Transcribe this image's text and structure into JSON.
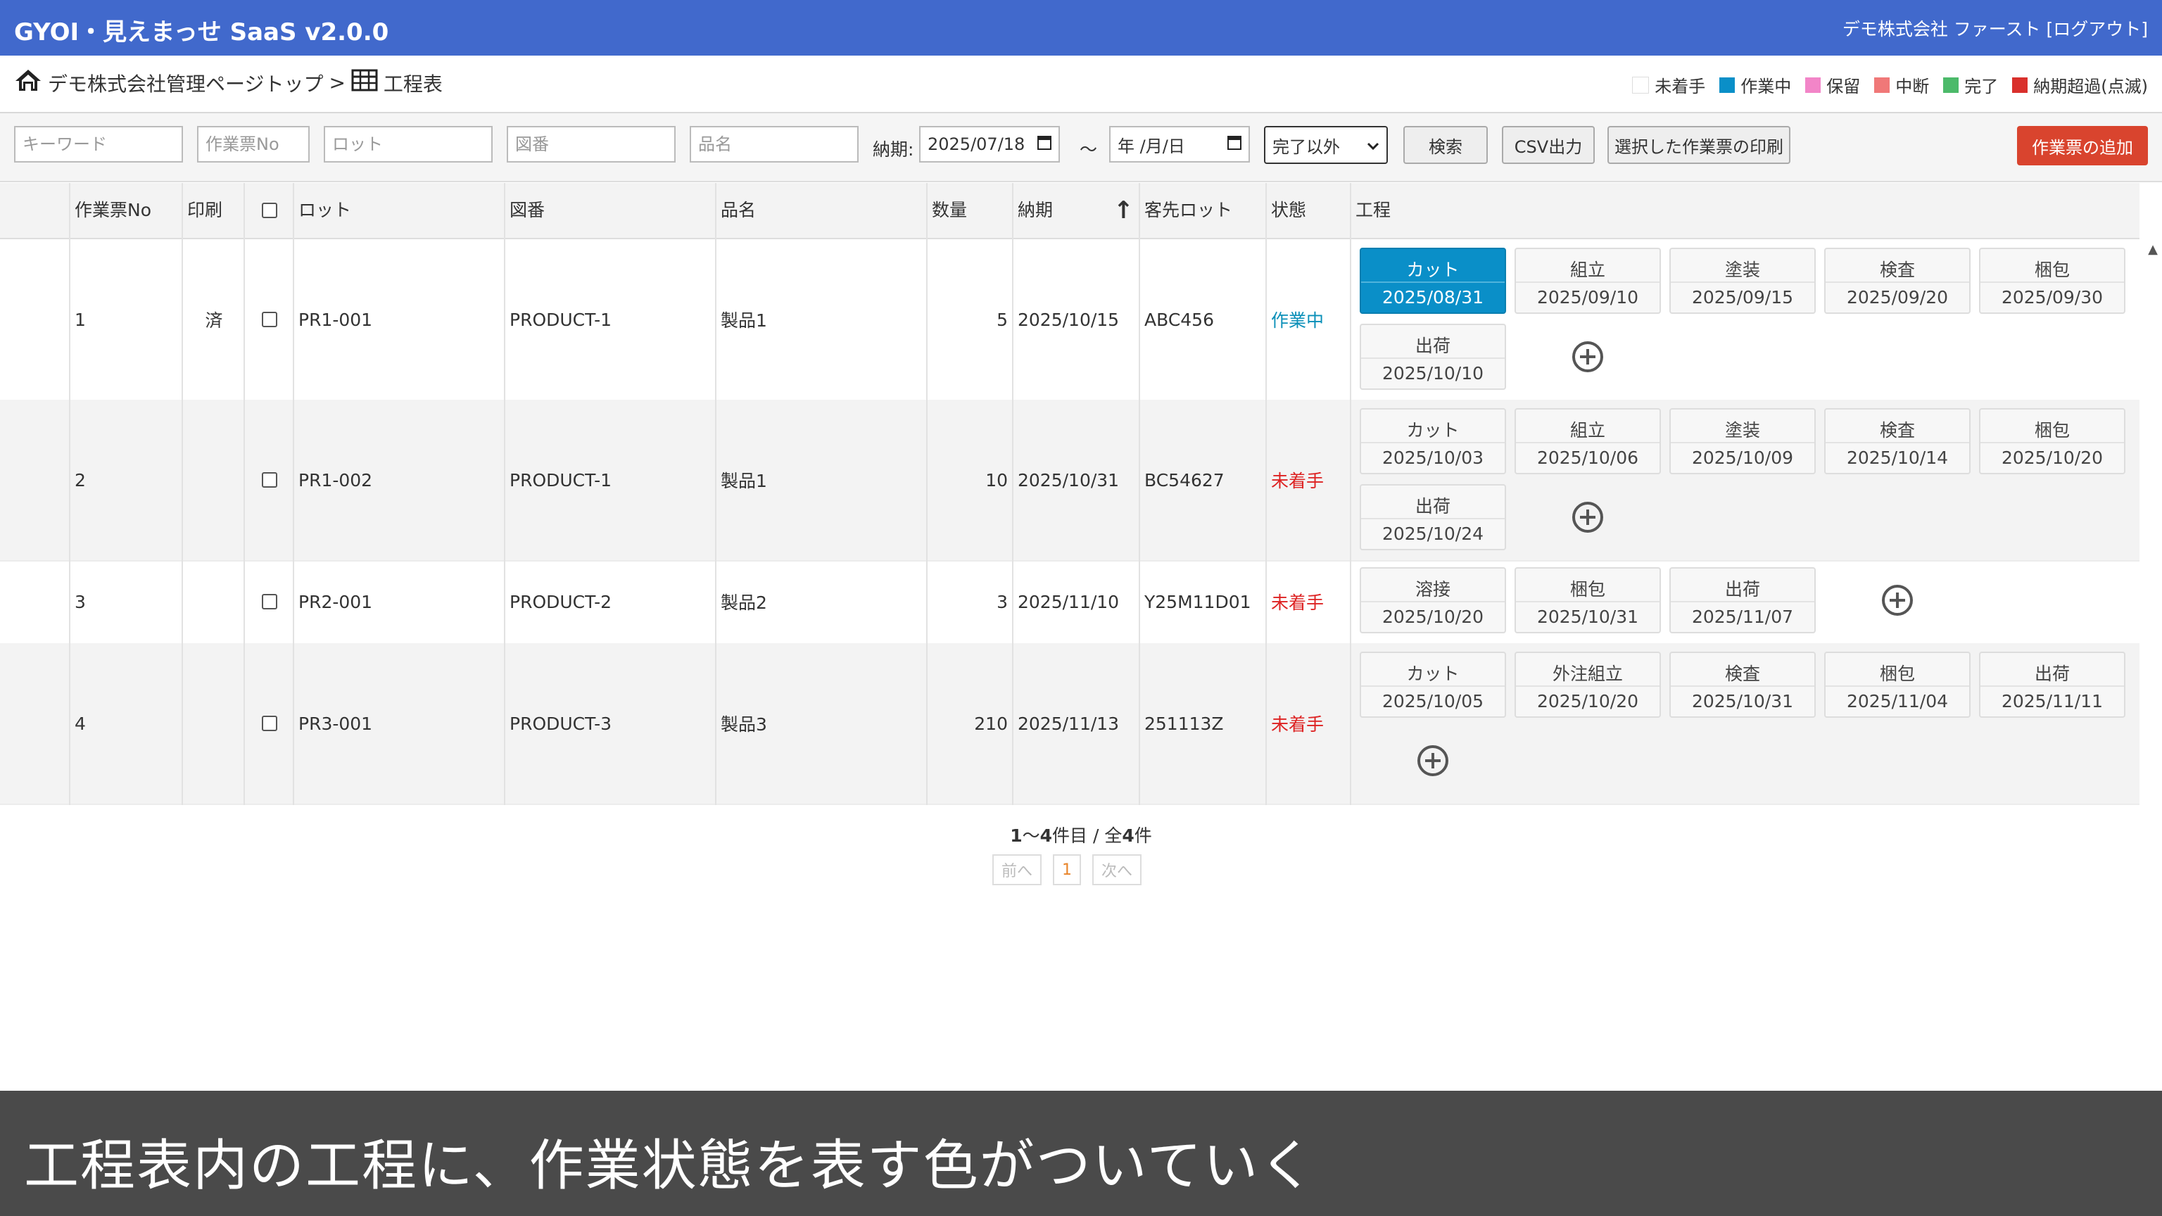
{
  "app": {
    "title": "GYOI・見えまっせ SaaS v2.0.0",
    "user_text": "デモ株式会社 ファースト [ログアウト]"
  },
  "breadcrumb": {
    "home": "デモ株式会社管理ページトップ",
    "separator": ">",
    "current": "工程表"
  },
  "legend": [
    {
      "label": "未着手",
      "color": "#ffffff"
    },
    {
      "label": "作業中",
      "color": "#0a8fc8"
    },
    {
      "label": "保留",
      "color": "#f285c8"
    },
    {
      "label": "中断",
      "color": "#f07878"
    },
    {
      "label": "完了",
      "color": "#4cba6a"
    },
    {
      "label": "納期超過(点滅)",
      "color": "#d9302c"
    }
  ],
  "filters": {
    "keyword_placeholder": "キーワード",
    "ticket_placeholder": "作業票No",
    "lot_placeholder": "ロット",
    "drawing_placeholder": "図番",
    "product_placeholder": "品名",
    "due_label": "納期:",
    "due_from": "2025/07/18",
    "tilde": "～",
    "due_to": "年 /月/日",
    "status_selected": "完了以外",
    "search": "検索",
    "csv": "CSV出力",
    "print_selected": "選択した作業票の印刷",
    "add_ticket": "作業票の追加"
  },
  "table": {
    "headers": {
      "ticket_no": "作業票No",
      "print": "印刷",
      "lot": "ロット",
      "drawing": "図番",
      "product": "品名",
      "qty": "数量",
      "due": "納期",
      "sort_icon": "↑",
      "customer_lot": "客先ロット",
      "status": "状態",
      "process": "工程"
    },
    "rows": [
      {
        "no": "1",
        "print": "済",
        "lot": "PR1-001",
        "drawing": "PRODUCT-1",
        "product": "製品1",
        "qty": "5",
        "due": "2025/10/15",
        "customer_lot": "ABC456",
        "status": "作業中",
        "procs": [
          {
            "name": "カット",
            "date": "2025/08/31",
            "state": "active"
          },
          {
            "name": "組立",
            "date": "2025/09/10"
          },
          {
            "name": "塗装",
            "date": "2025/09/15"
          },
          {
            "name": "検査",
            "date": "2025/09/20"
          },
          {
            "name": "梱包",
            "date": "2025/09/30"
          },
          {
            "name": "出荷",
            "date": "2025/10/10"
          }
        ]
      },
      {
        "no": "2",
        "print": "",
        "lot": "PR1-002",
        "drawing": "PRODUCT-1",
        "product": "製品1",
        "qty": "10",
        "due": "2025/10/31",
        "customer_lot": "BC54627",
        "status": "未着手",
        "procs": [
          {
            "name": "カット",
            "date": "2025/10/03"
          },
          {
            "name": "組立",
            "date": "2025/10/06"
          },
          {
            "name": "塗装",
            "date": "2025/10/09"
          },
          {
            "name": "検査",
            "date": "2025/10/14"
          },
          {
            "name": "梱包",
            "date": "2025/10/20"
          },
          {
            "name": "出荷",
            "date": "2025/10/24"
          }
        ]
      },
      {
        "no": "3",
        "print": "",
        "lot": "PR2-001",
        "drawing": "PRODUCT-2",
        "product": "製品2",
        "qty": "3",
        "due": "2025/11/10",
        "customer_lot": "Y25M11D01",
        "status": "未着手",
        "procs": [
          {
            "name": "溶接",
            "date": "2025/10/20"
          },
          {
            "name": "梱包",
            "date": "2025/10/31"
          },
          {
            "name": "出荷",
            "date": "2025/11/07"
          }
        ]
      },
      {
        "no": "4",
        "print": "",
        "lot": "PR3-001",
        "drawing": "PRODUCT-3",
        "product": "製品3",
        "qty": "210",
        "due": "2025/11/13",
        "customer_lot": "251113Z",
        "status": "未着手",
        "procs": [
          {
            "name": "カット",
            "date": "2025/10/05"
          },
          {
            "name": "外注組立",
            "date": "2025/10/20"
          },
          {
            "name": "検査",
            "date": "2025/10/31"
          },
          {
            "name": "梱包",
            "date": "2025/11/04"
          },
          {
            "name": "出荷",
            "date": "2025/11/11"
          }
        ]
      }
    ]
  },
  "pager": {
    "range_start": "1",
    "range_mid": "～",
    "range_end": "4",
    "range_suffix": "件目 / 全",
    "total": "4",
    "total_suffix": "件",
    "prev": "前へ",
    "page": "1",
    "next": "次へ"
  },
  "caption": "工程表内の工程に、作業状態を表す色がついていく"
}
